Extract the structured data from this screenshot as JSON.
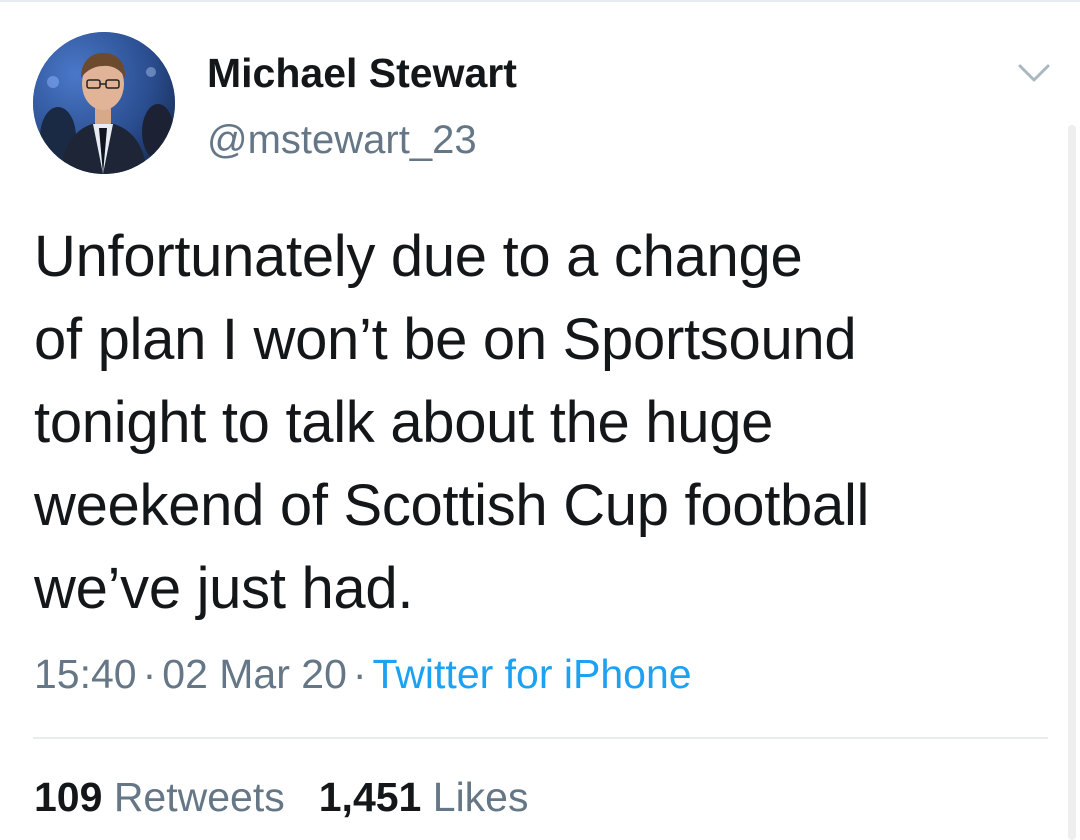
{
  "tweet": {
    "author": {
      "display_name": "Michael Stewart",
      "handle": "@mstewart_23",
      "avatar_icon": "avatar-photo"
    },
    "menu_icon": "chevron-down-icon",
    "text_lines": [
      "Unfortunately due to a change",
      "of plan I won’t be on Sportsound",
      "tonight to talk about the huge",
      "weekend of Scottish Cup football",
      "we’ve just had."
    ],
    "time": "15:40",
    "date": "02 Mar 20",
    "separator": "·",
    "source": "Twitter for iPhone",
    "stats": {
      "retweets_count": "109",
      "retweets_label": "Retweets",
      "likes_count": "1,451",
      "likes_label": "Likes"
    }
  },
  "colors": {
    "text": "#14171a",
    "secondary": "#657786",
    "link": "#1da1f2",
    "divider": "#e6ecf0"
  }
}
